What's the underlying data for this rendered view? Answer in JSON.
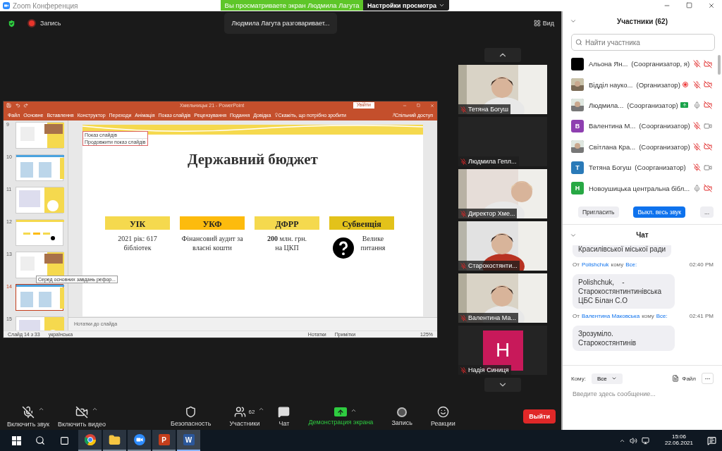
{
  "window": {
    "title": "Zoom Конференция"
  },
  "share_banner": {
    "text": "Вы просматриваете экран Людмила Лагута",
    "menu": "Настройки просмотра"
  },
  "top_bar": {
    "record_label": "Запись",
    "speaking": "Людмила Лагута разговаривает...",
    "view_label": "Вид"
  },
  "powerpoint": {
    "title": "Хмельницьк 21 - PowerPoint",
    "sign_in": "Увійти",
    "tabs": [
      "Файл",
      "Основне",
      "Вставлення",
      "Конструктор",
      "Переходи",
      "Анімація",
      "Показ слайдів",
      "Рецензування",
      "Подання",
      "Довідка"
    ],
    "tell_me": "Скажіть, що потрібно зробити",
    "share": "Спільний доступ",
    "thumbnails": [
      {
        "number": "9",
        "selected": false
      },
      {
        "number": "10",
        "selected": false
      },
      {
        "number": "11",
        "selected": false
      },
      {
        "number": "12",
        "selected": false
      },
      {
        "number": "13",
        "selected": false
      },
      {
        "number": "14",
        "selected": true
      },
      {
        "number": "15",
        "selected": false
      }
    ],
    "thumbnail_tooltip": "Серед основних завдань рефор...",
    "slideshow_popup": {
      "title": "Показ слайдів",
      "action": "Продовжити показ слайдів"
    },
    "slide": {
      "title": "Державний бюджет",
      "columns": [
        {
          "header": "УІК",
          "color": "#f5d94e",
          "kind": "text",
          "text": "2021 рік: 617 бібліотек"
        },
        {
          "header": "УКФ",
          "color": "#fdbb0d",
          "kind": "text",
          "text": "Фінансовий аудит за власні кошти"
        },
        {
          "header": "ДФРР",
          "color": "#f5d94e",
          "kind": "text",
          "text": "**200** млн. грн. на ЦКП"
        },
        {
          "header": "Субвенція",
          "color": "#e3c21a",
          "kind": "question",
          "text": "Велике питання"
        }
      ]
    },
    "notes": "Нотатки до слайда",
    "status": {
      "slide": "Слайд 14 з 33",
      "language": "українська",
      "notes": "Нотатки",
      "comments": "Примітки",
      "zoom": "125%"
    }
  },
  "video_strip": {
    "tiles": [
      {
        "name": "Тетяна Богуш",
        "kind": "video",
        "muted": true
      },
      {
        "name": "Людмила Гепл...",
        "kind": "blank",
        "muted": true
      },
      {
        "name": "Директор Хме...",
        "kind": "video",
        "muted": true
      },
      {
        "name": "Старокостянти...",
        "kind": "video",
        "muted": true
      },
      {
        "name": "Валентина Ма...",
        "kind": "video",
        "muted": true
      },
      {
        "name": "Надія Синиця",
        "kind": "letter",
        "letter": "Н",
        "color": "#c8195a",
        "muted": true
      }
    ]
  },
  "toolbar": {
    "items": [
      {
        "kind": "audio",
        "label": "Включить звук",
        "muted": true,
        "has_menu": true
      },
      {
        "kind": "video",
        "label": "Включить видео",
        "off": true,
        "has_menu": true
      },
      {
        "kind": "security",
        "label": "Безопасность",
        "has_menu": false
      },
      {
        "kind": "participants",
        "label": "Участники",
        "count": "62",
        "has_menu": true
      },
      {
        "kind": "chat",
        "label": "Чат",
        "has_menu": false
      },
      {
        "kind": "share",
        "label": "Демонстрация экрана",
        "active": true,
        "has_menu": true
      },
      {
        "kind": "record",
        "label": "Запись",
        "has_menu": false
      },
      {
        "kind": "reactions",
        "label": "Реакции",
        "has_menu": false
      }
    ],
    "leave": "Выйти"
  },
  "participants": {
    "title": "Участники (62)",
    "placeholder": "Найти участника",
    "items": [
      {
        "name": "Альона Ян...",
        "role": "(Соорганизатор, я)",
        "avatar": {
          "kind": "color",
          "color": "#000000"
        },
        "muted": true,
        "video_off": true
      },
      {
        "name": "Відділ науко...",
        "role": "(Организатор)",
        "recording": true,
        "muted": true,
        "video_off": true
      },
      {
        "name": "Людмила...",
        "role": "(Соорганизатор)",
        "sharing": true,
        "muted": false,
        "video_off": true
      },
      {
        "name": "Валентина М...",
        "role": "(Соорганизатор)",
        "avatar": {
          "kind": "letter",
          "letter": "В",
          "color": "#8e3fb0"
        },
        "muted": true,
        "video_off": false
      },
      {
        "name": "Світлана Кра...",
        "role": "(Соорганизатор)",
        "muted": true,
        "video_off": true
      },
      {
        "name": "Тетяна Богуш",
        "role": "(Соорганизатор)",
        "avatar": {
          "kind": "letter",
          "letter": "Т",
          "color": "#2a7ab8"
        },
        "muted": true,
        "video_off": false
      },
      {
        "name": "Новоушицька центральна бібл...",
        "avatar": {
          "kind": "letter",
          "letter": "Н",
          "color": "#27a844"
        },
        "muted": false,
        "video_off": true
      }
    ],
    "buttons": [
      {
        "kind": "plain",
        "label": "Пригласить"
      },
      {
        "kind": "primary",
        "label": "Выкл. весь звук"
      },
      {
        "kind": "more",
        "label": "..."
      }
    ]
  },
  "chat": {
    "title": "Чат",
    "messages": [
      {
        "text": "Красилівської міської ради"
      },
      {
        "from_prefix": "От",
        "from": "Polishchuk",
        "to_prefix": "кому",
        "to": "Все:",
        "time": "02:40 PM",
        "text": "Polishchuk,    - Старокостянтинтинівська ЦБС Білан С.О"
      },
      {
        "from_prefix": "От",
        "from": "Валентина Маковська",
        "to_prefix": "кому",
        "to": "Все:",
        "time": "02:41 PM",
        "text": "Зрозуміло. Старокостянтинів"
      }
    ],
    "to_label": "Кому:",
    "recipient": "Все",
    "file_label": "Файл",
    "placeholder": "Введите здесь сообщение..."
  },
  "taskbar": {
    "apps": [
      {
        "kind": "browser",
        "selected": false
      },
      {
        "kind": "folder",
        "selected": false
      },
      {
        "kind": "zoom",
        "selected": false
      },
      {
        "kind": "powerpoint",
        "letter": "P",
        "selected": false
      },
      {
        "kind": "word",
        "letter": "W",
        "selected": true
      }
    ],
    "time": "15:06",
    "date": "22.06.2021"
  }
}
